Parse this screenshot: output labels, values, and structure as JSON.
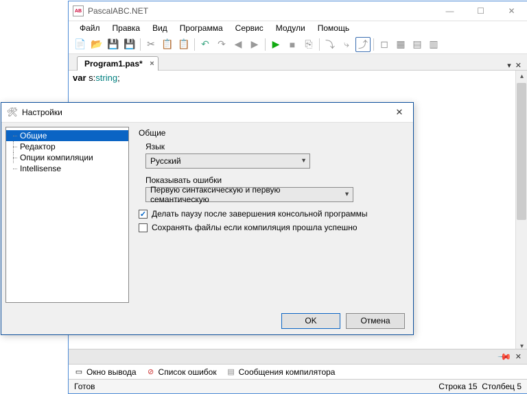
{
  "app": {
    "title": "PascalABC.NET",
    "menus": [
      "Файл",
      "Правка",
      "Вид",
      "Программа",
      "Сервис",
      "Модули",
      "Помощь"
    ],
    "tab": "Program1.pas*",
    "code_kw": "var",
    "code_var": " s:",
    "code_type": "string",
    "code_end": ";"
  },
  "bottom_tabs": {
    "output": "Окно вывода",
    "errors": "Список ошибок",
    "compiler": "Сообщения компилятора"
  },
  "status": {
    "left": "Готов",
    "right_line": "Строка  15",
    "right_col": "Столбец  5"
  },
  "dialog": {
    "title": "Настройки",
    "tree": [
      "Общие",
      "Редактор",
      "Опции компиляции",
      "Intellisense"
    ],
    "section": "Общие",
    "lang_label": "Язык",
    "lang_value": "Русский",
    "errors_label": "Показывать ошибки",
    "errors_value": "Первую синтаксическую и первую семантическую",
    "chk1": "Делать паузу после завершения консольной программы",
    "chk2": "Сохранять файлы если компиляция прошла успешно",
    "ok": "OK",
    "cancel": "Отмена"
  }
}
